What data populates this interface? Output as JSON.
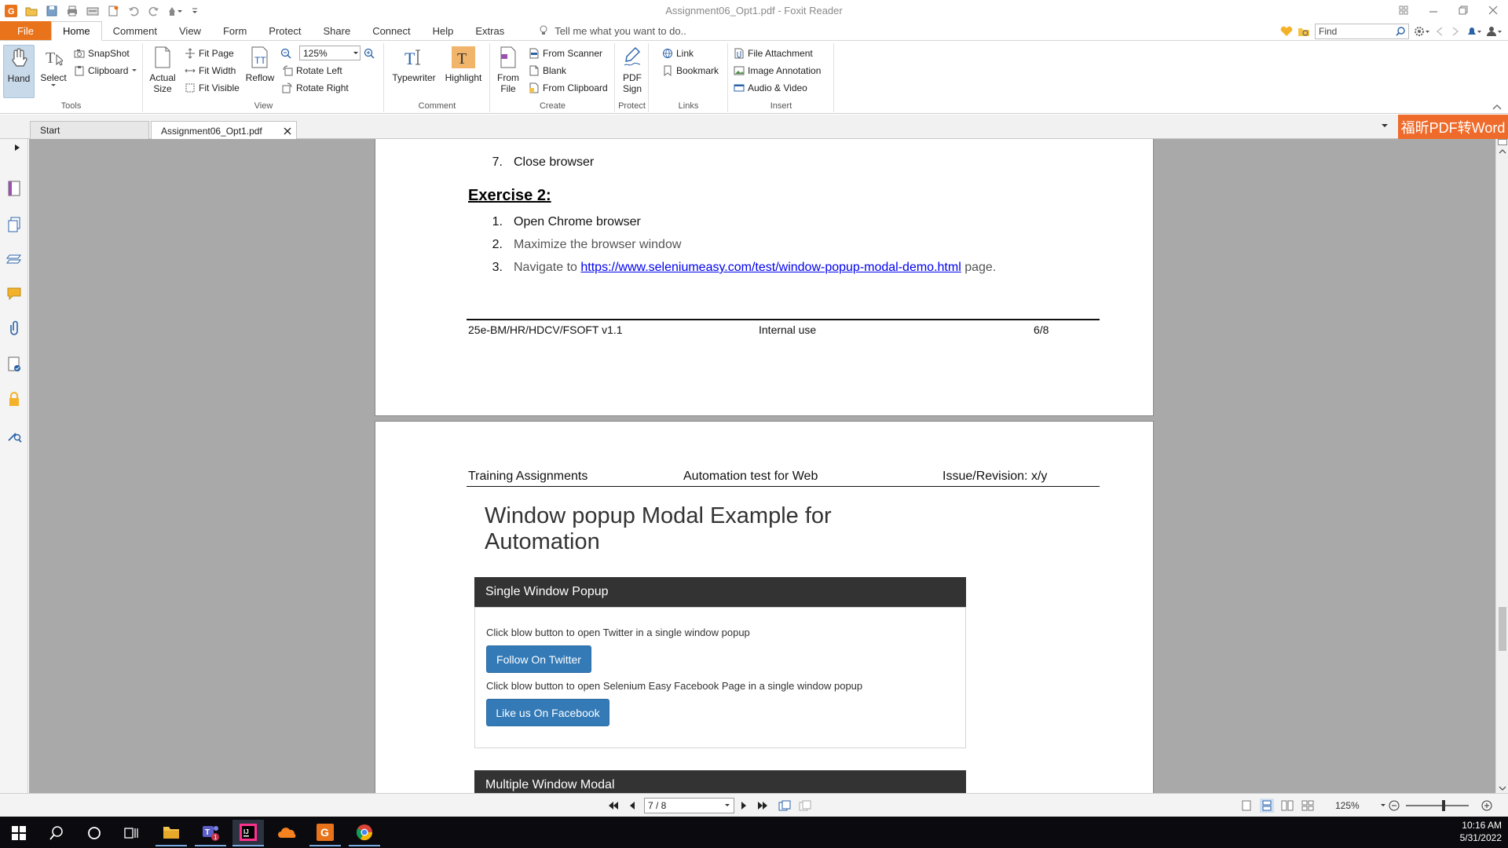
{
  "app": {
    "title": "Assignment06_Opt1.pdf - Foxit Reader"
  },
  "menu": {
    "tabs": [
      "File",
      "Home",
      "Comment",
      "View",
      "Form",
      "Protect",
      "Share",
      "Connect",
      "Help",
      "Extras"
    ],
    "active": "Home",
    "tell_me": "Tell me what you want to do..",
    "find_placeholder": "Find"
  },
  "ribbon": {
    "tools": {
      "label": "Tools",
      "hand": "Hand",
      "select": "Select",
      "snapshot": "SnapShot",
      "clipboard": "Clipboard"
    },
    "view": {
      "label": "View",
      "actual_size_1": "Actual",
      "actual_size_2": "Size",
      "fit_page": "Fit Page",
      "fit_width": "Fit Width",
      "fit_visible": "Fit Visible",
      "reflow": "Reflow",
      "zoom": "125%",
      "rotate_left": "Rotate Left",
      "rotate_right": "Rotate Right"
    },
    "comment": {
      "label": "Comment",
      "typewriter": "Typewriter",
      "highlight": "Highlight"
    },
    "create": {
      "label": "Create",
      "from_file_1": "From",
      "from_file_2": "File",
      "from_scanner": "From Scanner",
      "blank": "Blank",
      "from_clipboard": "From Clipboard"
    },
    "protect": {
      "label": "Protect",
      "pdf_sign_1": "PDF",
      "pdf_sign_2": "Sign"
    },
    "links": {
      "label": "Links",
      "link": "Link",
      "bookmark": "Bookmark"
    },
    "insert": {
      "label": "Insert",
      "file_attachment": "File Attachment",
      "image_annotation": "Image Annotation",
      "audio_video": "Audio & Video"
    }
  },
  "doc_tabs": {
    "start": "Start",
    "current": "Assignment06_Opt1.pdf",
    "convert_button": "福昕PDF转Word"
  },
  "page6": {
    "step7_num": "7.",
    "step7": "Close browser",
    "exercise_heading": "Exercise 2:",
    "steps": [
      {
        "num": "1.",
        "text": "Open Chrome browser"
      },
      {
        "num": "2.",
        "text": "Maximize the browser window"
      },
      {
        "num": "3.",
        "prefix": "Navigate to ",
        "link": "https://www.seleniumeasy.com/test/window-popup-modal-demo.html",
        "suffix": " page."
      }
    ],
    "footer": {
      "left": "25e-BM/HR/HDCV/FSOFT v1.1",
      "center": "Internal use",
      "right": "6/8"
    }
  },
  "page7": {
    "header": {
      "left": "Training Assignments",
      "center": "Automation test for Web",
      "right": "Issue/Revision: x/y"
    },
    "embedded": {
      "title_line1": "Window popup Modal Example for",
      "title_line2": "Automation",
      "single_panel_title": "Single Window Popup",
      "twitter_desc": "Click blow button to open Twitter in a single window popup",
      "twitter_button": "Follow On Twitter",
      "facebook_desc": "Click blow button to open Selenium Easy Facebook Page in a single window popup",
      "facebook_button": "Like us On Facebook",
      "multiple_panel_title": "Multiple Window Modal"
    }
  },
  "status": {
    "page_indicator": "7 / 8",
    "zoom": "125%"
  },
  "taskbar": {
    "time": "10:16 AM",
    "date": "5/31/2022"
  },
  "colors": {
    "file_tab": "#e8731b",
    "convert_button": "#ef6b2b",
    "panel_header": "#333333",
    "bootstrap_button": "#337ab7",
    "link": "#0000ee"
  }
}
